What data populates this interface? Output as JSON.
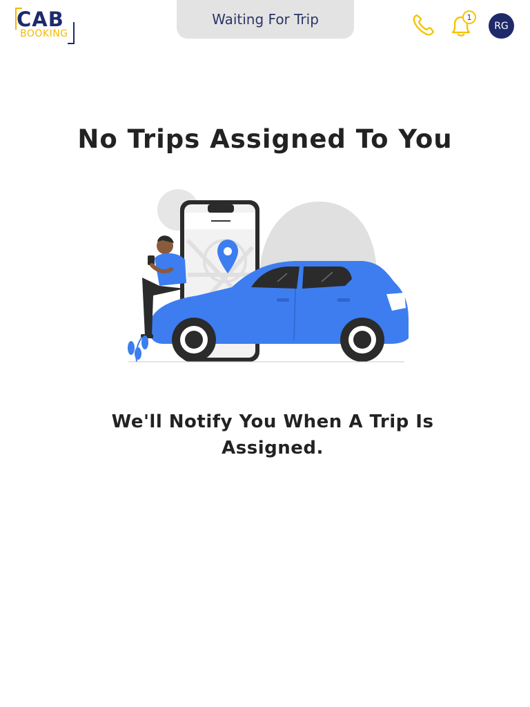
{
  "header": {
    "logo": {
      "primary_text": "CAB",
      "secondary_text": "BOOKING",
      "colors": {
        "navy": "#1f2a6b",
        "yellow": "#f5b800"
      }
    },
    "status_label": "Waiting For Trip",
    "phone_icon": "phone-icon",
    "notifications": {
      "icon": "bell-icon",
      "count": "1"
    },
    "user": {
      "initials": "RG"
    }
  },
  "main": {
    "title": "No Trips Assigned To You",
    "illustration": "person-with-phone-and-car-illustration",
    "message": "We'll Notify You When A Trip Is Assigned."
  },
  "colors": {
    "accent_blue": "#3d7df0",
    "navy": "#1f2a6b",
    "yellow": "#f5c400",
    "pill_bg": "#e3e3e3"
  }
}
